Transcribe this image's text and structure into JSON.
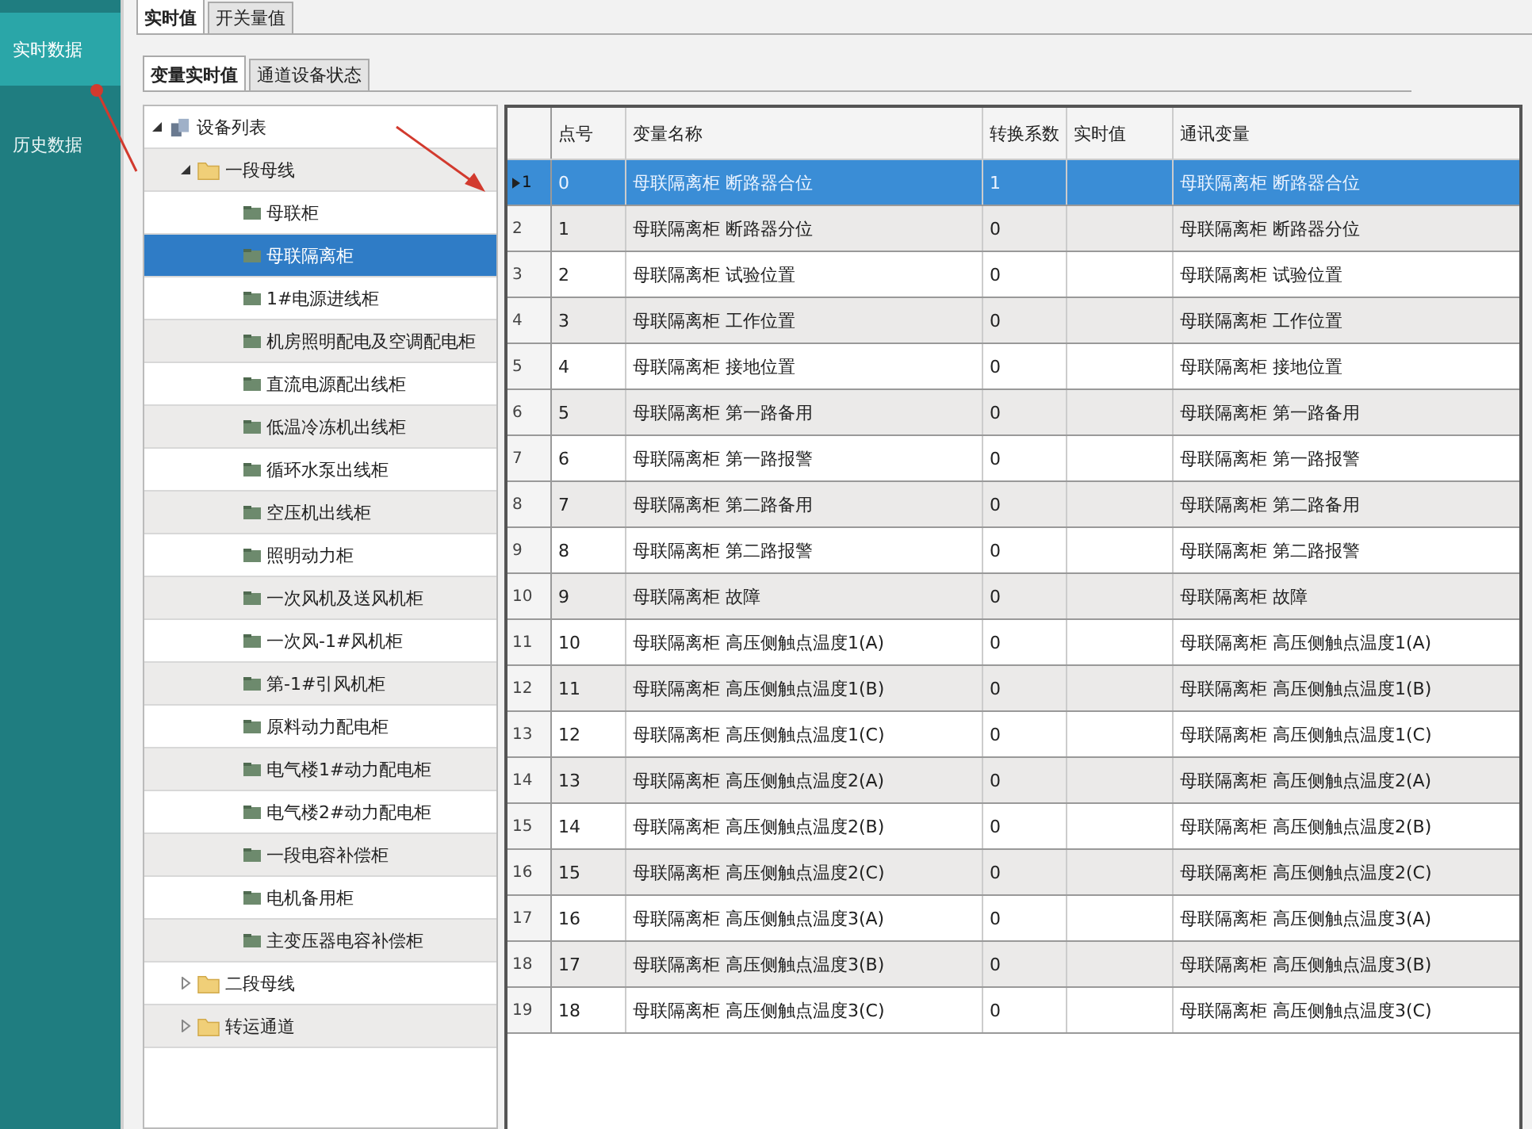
{
  "sidebar": {
    "items": [
      {
        "label": "实时数据",
        "selected": true
      },
      {
        "label": "历史数据",
        "selected": false
      }
    ]
  },
  "tabs": [
    {
      "label": "实时值",
      "selected": true
    },
    {
      "label": "开关量值",
      "selected": false
    }
  ],
  "subtabs": [
    {
      "label": "变量实时值",
      "selected": true
    },
    {
      "label": "通道设备状态",
      "selected": false
    }
  ],
  "tree": {
    "label": "设备列表",
    "expanded": true,
    "selected": false,
    "children": [
      {
        "label": "一段母线",
        "expanded": true,
        "selected": false,
        "children": [
          {
            "label": "母联柜",
            "selected": false
          },
          {
            "label": "母联隔离柜",
            "selected": true
          },
          {
            "label": "1#电源进线柜",
            "selected": false
          },
          {
            "label": "机房照明配电及空调配电柜",
            "selected": false
          },
          {
            "label": "直流电源配出线柜",
            "selected": false
          },
          {
            "label": "低温冷冻机出线柜",
            "selected": false
          },
          {
            "label": "循环水泵出线柜",
            "selected": false
          },
          {
            "label": "空压机出线柜",
            "selected": false
          },
          {
            "label": "照明动力柜",
            "selected": false
          },
          {
            "label": "一次风机及送风机柜",
            "selected": false
          },
          {
            "label": "一次风-1#风机柜",
            "selected": false
          },
          {
            "label": "第-1#引风机柜",
            "selected": false
          },
          {
            "label": "原料动力配电柜",
            "selected": false
          },
          {
            "label": "电气楼1#动力配电柜",
            "selected": false
          },
          {
            "label": "电气楼2#动力配电柜",
            "selected": false
          },
          {
            "label": "一段电容补偿柜",
            "selected": false
          },
          {
            "label": "电机备用柜",
            "selected": false
          },
          {
            "label": "主变压器电容补偿柜",
            "selected": false
          }
        ]
      },
      {
        "label": "二段母线",
        "expanded": false,
        "selected": false
      },
      {
        "label": "转运通道",
        "expanded": false,
        "selected": false
      }
    ]
  },
  "table": {
    "columns": [
      "点号",
      "变量名称",
      "转换系数",
      "实时值",
      "通讯变量"
    ],
    "rows": [
      {
        "index": "1",
        "point": "0",
        "name": "母联隔离柜 断路器合位",
        "factor": "1",
        "comm": "母联隔离柜 断路器合位",
        "selected": true
      },
      {
        "index": "2",
        "point": "1",
        "name": "母联隔离柜 断路器分位",
        "factor": "0",
        "comm": "母联隔离柜 断路器分位",
        "selected": false
      },
      {
        "index": "3",
        "point": "2",
        "name": "母联隔离柜 试验位置",
        "factor": "0",
        "comm": "母联隔离柜 试验位置",
        "selected": false
      },
      {
        "index": "4",
        "point": "3",
        "name": "母联隔离柜 工作位置",
        "factor": "0",
        "comm": "母联隔离柜 工作位置",
        "selected": false
      },
      {
        "index": "5",
        "point": "4",
        "name": "母联隔离柜 接地位置",
        "factor": "0",
        "comm": "母联隔离柜 接地位置",
        "selected": false
      },
      {
        "index": "6",
        "point": "5",
        "name": "母联隔离柜 第一路备用",
        "factor": "0",
        "comm": "母联隔离柜 第一路备用",
        "selected": false
      },
      {
        "index": "7",
        "point": "6",
        "name": "母联隔离柜 第一路报警",
        "factor": "0",
        "comm": "母联隔离柜 第一路报警",
        "selected": false
      },
      {
        "index": "8",
        "point": "7",
        "name": "母联隔离柜 第二路备用",
        "factor": "0",
        "comm": "母联隔离柜 第二路备用",
        "selected": false
      },
      {
        "index": "9",
        "point": "8",
        "name": "母联隔离柜 第二路报警",
        "factor": "0",
        "comm": "母联隔离柜 第二路报警",
        "selected": false
      },
      {
        "index": "10",
        "point": "9",
        "name": "母联隔离柜 故障",
        "factor": "0",
        "comm": "母联隔离柜 故障",
        "selected": false
      },
      {
        "index": "11",
        "point": "10",
        "name": "母联隔离柜 高压侧触点温度1(A)",
        "factor": "0",
        "comm": "母联隔离柜 高压侧触点温度1(A)",
        "selected": false
      },
      {
        "index": "12",
        "point": "11",
        "name": "母联隔离柜 高压侧触点温度1(B)",
        "factor": "0",
        "comm": "母联隔离柜 高压侧触点温度1(B)",
        "selected": false
      },
      {
        "index": "13",
        "point": "12",
        "name": "母联隔离柜 高压侧触点温度1(C)",
        "factor": "0",
        "comm": "母联隔离柜 高压侧触点温度1(C)",
        "selected": false
      },
      {
        "index": "14",
        "point": "13",
        "name": "母联隔离柜 高压侧触点温度2(A)",
        "factor": "0",
        "comm": "母联隔离柜 高压侧触点温度2(A)",
        "selected": false
      },
      {
        "index": "15",
        "point": "14",
        "name": "母联隔离柜 高压侧触点温度2(B)",
        "factor": "0",
        "comm": "母联隔离柜 高压侧触点温度2(B)",
        "selected": false
      },
      {
        "index": "16",
        "point": "15",
        "name": "母联隔离柜 高压侧触点温度2(C)",
        "factor": "0",
        "comm": "母联隔离柜 高压侧触点温度2(C)",
        "selected": false
      },
      {
        "index": "17",
        "point": "16",
        "name": "母联隔离柜 高压侧触点温度3(A)",
        "factor": "0",
        "comm": "母联隔离柜 高压侧触点温度3(A)",
        "selected": false
      },
      {
        "index": "18",
        "point": "17",
        "name": "母联隔离柜 高压侧触点温度3(B)",
        "factor": "0",
        "comm": "母联隔离柜 高压侧触点温度3(B)",
        "selected": false
      },
      {
        "index": "19",
        "point": "18",
        "name": "母联隔离柜 高压侧触点温度3(C)",
        "factor": "0",
        "comm": "母联隔离柜 高压侧触点温度3(C)",
        "selected": false
      }
    ]
  }
}
